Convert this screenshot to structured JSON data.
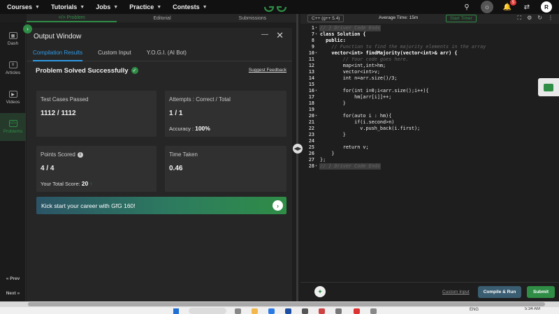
{
  "topnav": {
    "items": [
      {
        "label": "Courses"
      },
      {
        "label": "Tutorials"
      },
      {
        "label": "Jobs"
      },
      {
        "label": "Practice"
      },
      {
        "label": "Contests"
      }
    ],
    "notification_count": "5",
    "avatar_initial": "R"
  },
  "problem_tabs": {
    "problem": "</> Problem",
    "editorial": "Editorial",
    "submissions": "Submissions"
  },
  "sidebar": {
    "items": [
      {
        "label": "Dash",
        "icon": "dashboard-icon"
      },
      {
        "label": "Articles",
        "icon": "articles-icon"
      },
      {
        "label": "Videos",
        "icon": "videos-icon"
      },
      {
        "label": "Problems",
        "icon": "code-icon"
      }
    ],
    "prev": "« Prev",
    "next": "Next »"
  },
  "output_window": {
    "title": "Output Window",
    "tabs": {
      "compilation": "Compilation Results",
      "custom_input": "Custom Input",
      "yogi": "Y.O.G.I. (AI Bot)"
    },
    "status": "Problem Solved Successfully",
    "suggest_feedback": "Suggest Feedback",
    "test_cases": {
      "label": "Test Cases Passed",
      "value": "1112 / 1112"
    },
    "attempts": {
      "label": "Attempts : Correct / Total",
      "value": "1 / 1",
      "accuracy_label": "Accuracy : ",
      "accuracy_value": "100%"
    },
    "points": {
      "label": "Points Scored",
      "value": "4 / 4",
      "total_label": "Your Total Score: ",
      "total_value": "20"
    },
    "time_taken": {
      "label": "Time Taken",
      "value": "0.46"
    },
    "banner": "Kick start your career with GfG 160!"
  },
  "editor": {
    "language": "C++ (g++ 5.4)",
    "average_time": "Average Time: 15m",
    "timer": "Start Timer",
    "lines": [
      {
        "n": "1",
        "text": "// } Driver Code Ends",
        "type": "cm",
        "fold": true,
        "hl": true
      },
      {
        "n": "7",
        "text": "class Solution {",
        "type": "kw",
        "fold": true
      },
      {
        "n": "8",
        "text": "  public:",
        "type": "kw"
      },
      {
        "n": "9",
        "text": "    // Function to find the majority elements in the array",
        "type": "cm"
      },
      {
        "n": "10",
        "text": "    vector<int> findMajority(vector<int>& arr) {",
        "type": "kw",
        "fold": true
      },
      {
        "n": "11",
        "text": "        // Your code goes here.",
        "type": "cm"
      },
      {
        "n": "12",
        "text": "        map<int,int>hm;",
        "type": "tx"
      },
      {
        "n": "13",
        "text": "        vector<int>v;",
        "type": "tx"
      },
      {
        "n": "14",
        "text": "        int n=arr.size()/3;",
        "type": "tx"
      },
      {
        "n": "15",
        "text": "",
        "type": "tx"
      },
      {
        "n": "16",
        "text": "        for(int i=0;i<arr.size();i++){",
        "type": "tx",
        "fold": true
      },
      {
        "n": "17",
        "text": "            hm[arr[i]]++;",
        "type": "tx"
      },
      {
        "n": "18",
        "text": "        }",
        "type": "tx"
      },
      {
        "n": "19",
        "text": "",
        "type": "tx"
      },
      {
        "n": "20",
        "text": "        for(auto i : hm){",
        "type": "tx",
        "fold": true
      },
      {
        "n": "21",
        "text": "            if(i.second>n)",
        "type": "tx"
      },
      {
        "n": "22",
        "text": "              v.push_back(i.first);",
        "type": "tx"
      },
      {
        "n": "23",
        "text": "        }",
        "type": "tx"
      },
      {
        "n": "24",
        "text": "",
        "type": "tx"
      },
      {
        "n": "25",
        "text": "        return v;",
        "type": "tx"
      },
      {
        "n": "26",
        "text": "    }",
        "type": "tx"
      },
      {
        "n": "27",
        "text": "};",
        "type": "tx"
      },
      {
        "n": "28",
        "text": "// } Driver Code Ends",
        "type": "cm",
        "fold": true,
        "hl": true
      }
    ],
    "footer": {
      "custom_input": "Custom Input",
      "compile": "Compile & Run",
      "submit": "Submit"
    }
  },
  "taskbar": {
    "lang": "ENG",
    "time": "5:34 AM"
  },
  "colors": {
    "brand_green": "#2f8d46",
    "tab_blue": "#2f9be6",
    "panel_bg": "#262626",
    "card_bg": "#303030"
  }
}
